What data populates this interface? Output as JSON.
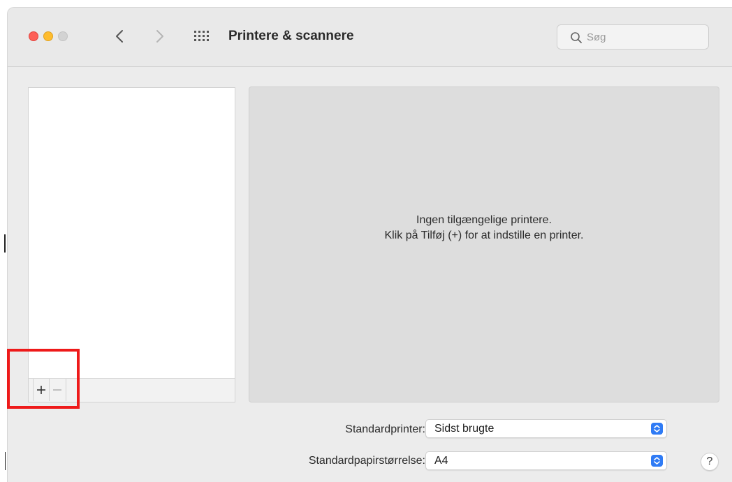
{
  "window": {
    "title": "Printere & scannere"
  },
  "search": {
    "placeholder": "Søg"
  },
  "printer_list": {
    "add_label": "+",
    "remove_label": "−"
  },
  "detail": {
    "empty_line1": "Ingen tilgængelige printere.",
    "empty_line2": "Klik på Tilføj (+) for at indstille en printer."
  },
  "form": {
    "default_printer_label": "Standardprinter:",
    "default_printer_value": "Sidst brugte",
    "paper_size_label": "Standardpapirstørrelse:",
    "paper_size_value": "A4"
  },
  "help": {
    "label": "?"
  },
  "colors": {
    "accent": "#2f7bf5",
    "highlight": "#ee1a1a",
    "close": "#fd5f57",
    "minimize": "#febc2e"
  },
  "icons": [
    "back-chevron-icon",
    "forward-chevron-icon",
    "grid-icon",
    "search-icon",
    "stepper-chevron-icon"
  ]
}
